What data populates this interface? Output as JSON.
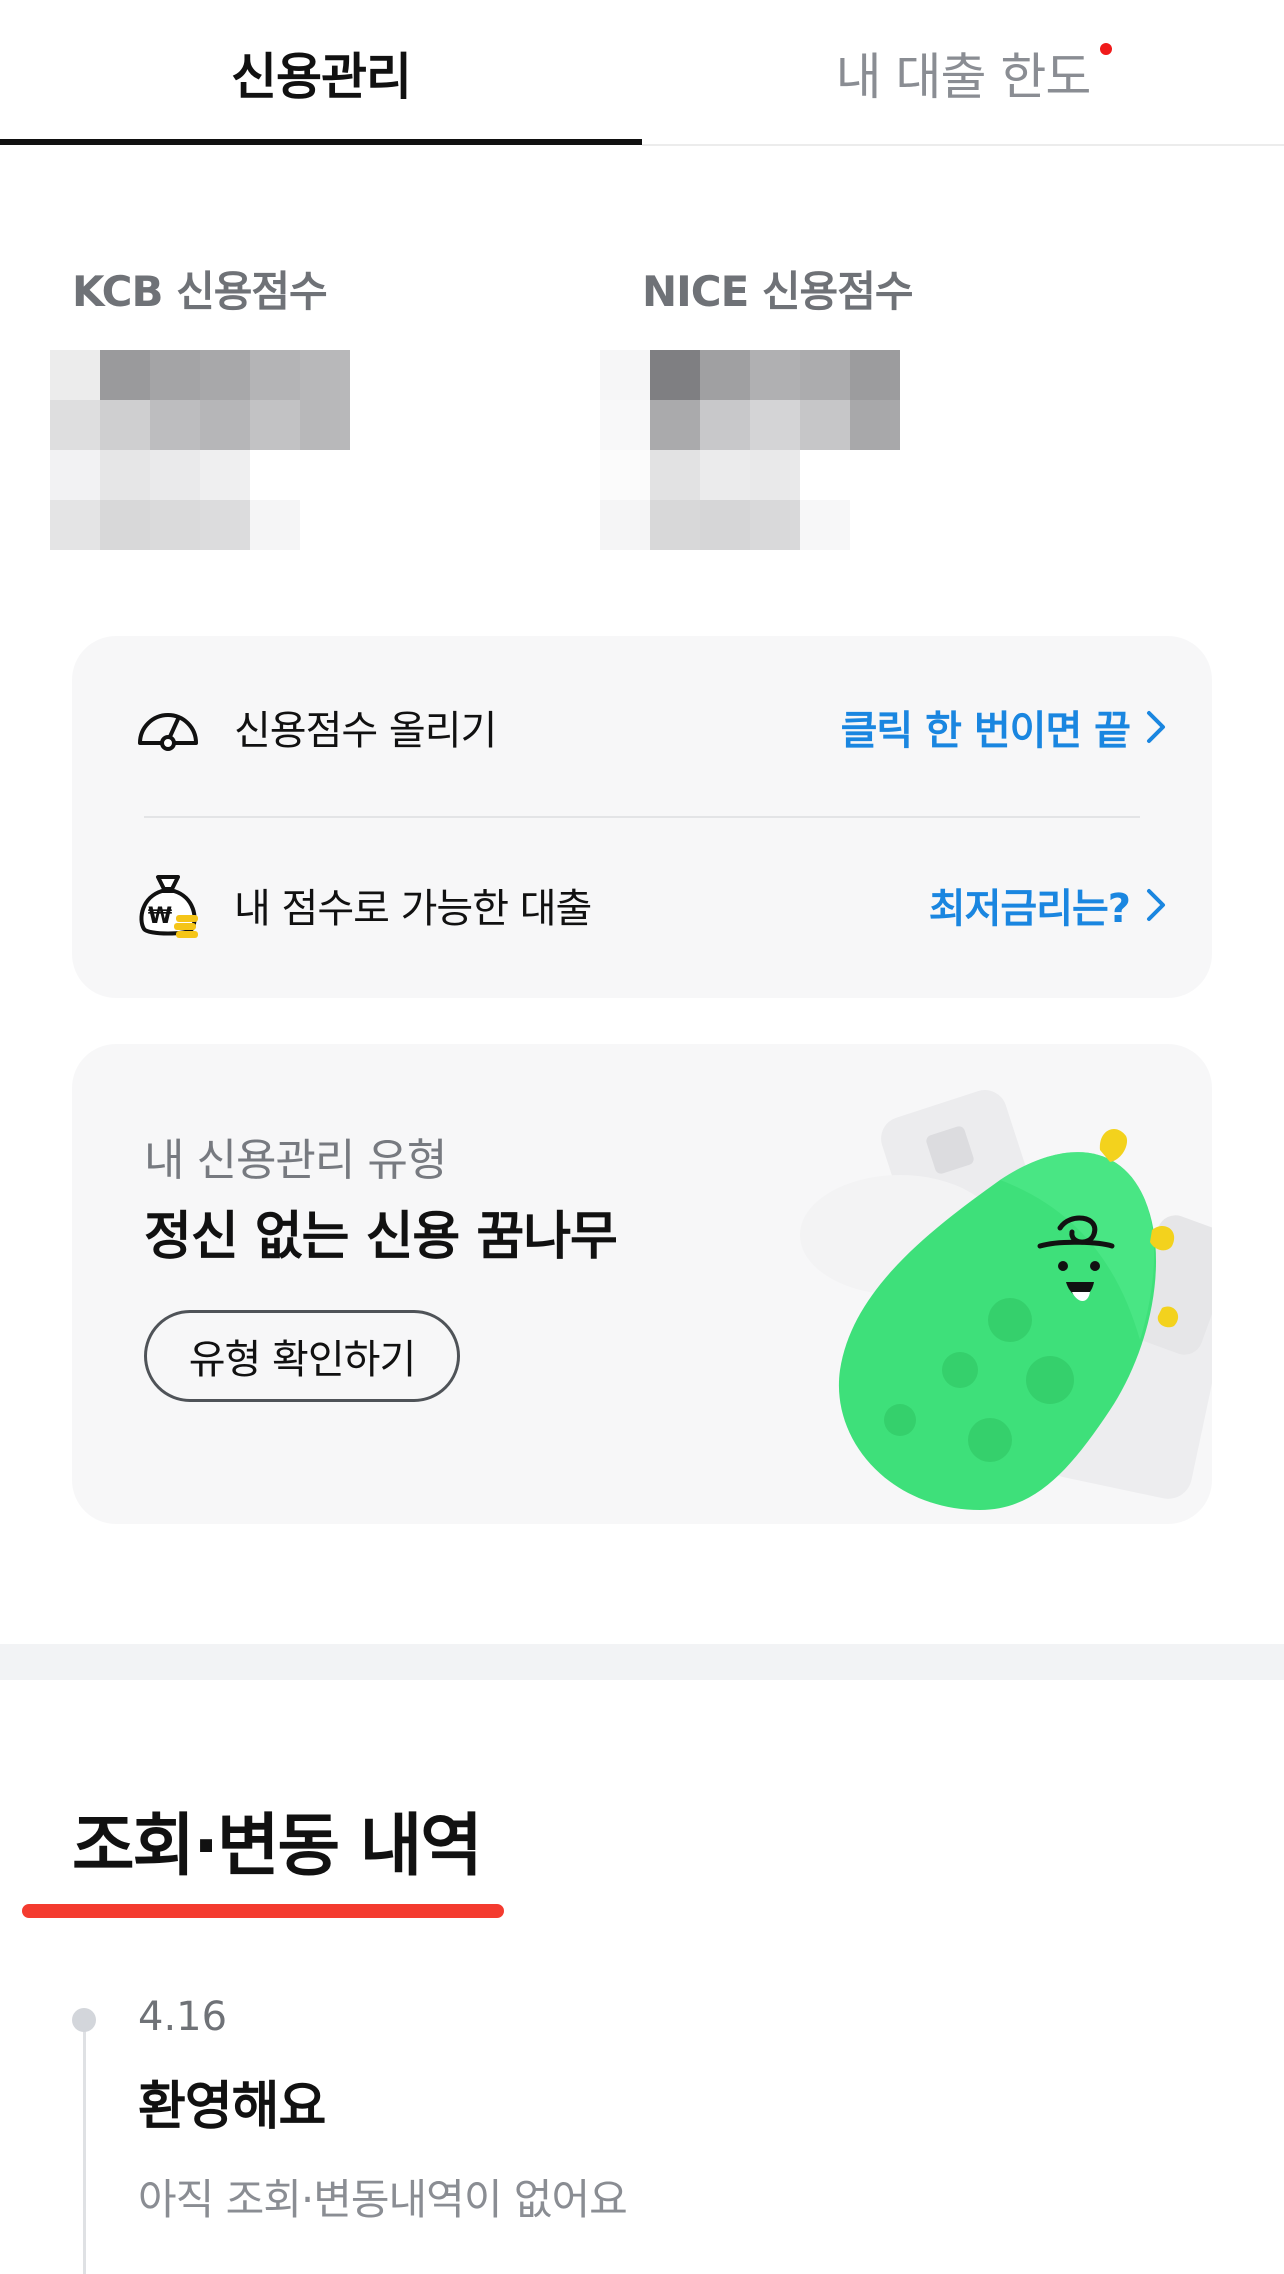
{
  "tabs": {
    "active_label": "신용관리",
    "inactive_label": "내 대출 한도",
    "notification_color": "#f01a1a"
  },
  "scores": {
    "kcb_label": "KCB 신용점수",
    "nice_label": "NICE 신용점수"
  },
  "menu": {
    "items": [
      {
        "icon": "speedometer-icon",
        "label": "신용점수 올리기",
        "link": "클릭 한 번이면 끝"
      },
      {
        "icon": "money-bag-icon",
        "label": "내 점수로 가능한 대출",
        "link": "최저금리는?"
      }
    ],
    "link_color": "#1a86e0"
  },
  "credit_type": {
    "subtitle": "내 신용관리 유형",
    "title": "정신 없는 신용 꿈나무",
    "button_label": "유형 확인하기"
  },
  "history": {
    "title": "조회·변동 내역",
    "accent_color": "#f43b2f",
    "entries": [
      {
        "date": "4.16",
        "title": "환영해요",
        "description": "아직 조회·변동내역이 없어요"
      }
    ]
  }
}
